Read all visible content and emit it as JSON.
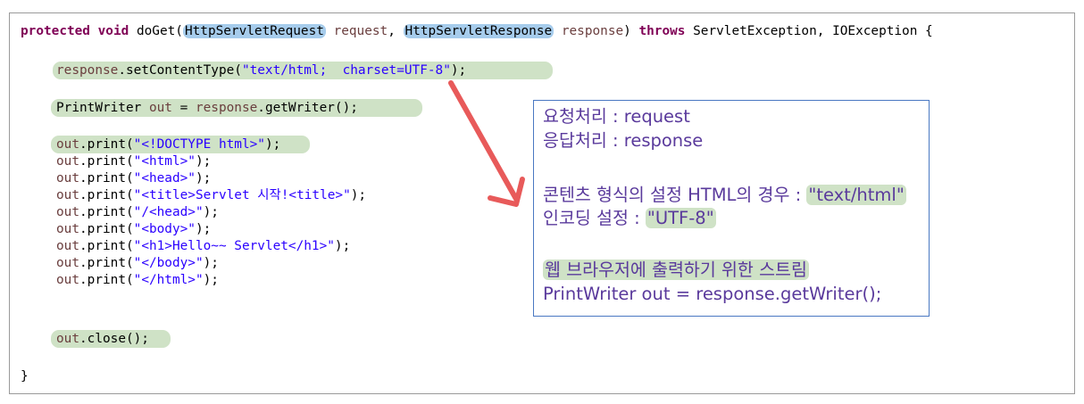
{
  "code": {
    "signature": {
      "modifiers": "protected void",
      "method_open": " doGet(",
      "request_type": "HttpServletRequest",
      "request_param": " request",
      "comma": ", ",
      "response_type": "HttpServletResponse",
      "response_param": " response",
      "close_paren": ") ",
      "throws_kw": "throws",
      "exceptions": " ServletException, IOException {"
    },
    "set_content_type": {
      "obj": "response",
      "call": ".setContentType(",
      "arg": "\"text/html;  charset=UTF-8\"",
      "end": ");"
    },
    "print_writer": {
      "type": "PrintWriter ",
      "var": "out",
      "eq": " = ",
      "obj": "response",
      "call": ".getWriter();"
    },
    "print_lines": [
      {
        "obj": "out",
        "call": ".print(",
        "arg": "\"<!DOCTYPE html>\"",
        "end": ");"
      },
      {
        "obj": "out",
        "call": ".print(",
        "arg": "\"<html>\"",
        "end": ");"
      },
      {
        "obj": "out",
        "call": ".print(",
        "arg": "\"<head>\"",
        "end": ");"
      },
      {
        "obj": "out",
        "call": ".print(",
        "arg": "\"<title>Servlet 시작!<title>\"",
        "end": ");"
      },
      {
        "obj": "out",
        "call": ".print(",
        "arg": "\"/<head>\"",
        "end": ");"
      },
      {
        "obj": "out",
        "call": ".print(",
        "arg": "\"<body>\"",
        "end": ");"
      },
      {
        "obj": "out",
        "call": ".print(",
        "arg": "\"<h1>Hello~~ Servlet</h1>\"",
        "end": ");"
      },
      {
        "obj": "out",
        "call": ".print(",
        "arg": "\"</body>\"",
        "end": ");"
      },
      {
        "obj": "out",
        "call": ".print(",
        "arg": "\"</html>\"",
        "end": ");"
      }
    ],
    "close_line": {
      "obj": "out",
      "call": ".close();"
    },
    "closing_brace": "}"
  },
  "note": {
    "request_line": "요청처리 : request",
    "response_line": "응답처리 : response",
    "content_type_prefix": "콘텐츠 형식의 설정 HTML의 경우 : ",
    "content_type_value": "\"text/html\"",
    "encoding_prefix": "인코딩 설정 : ",
    "encoding_value": "\"UTF-8\"",
    "stream_desc": "웹 브라우저에 출력하기 위한 스트림",
    "stream_code": "PrintWriter out = response.getWriter();"
  },
  "colors": {
    "keyword": "#7f0055",
    "string": "#2a00ff",
    "field": "#0000c0",
    "highlight_green": "#cfe2c6",
    "highlight_blue": "#a6ccec",
    "note_text": "#5a3a9c",
    "note_border": "#4a78c2",
    "arrow": "#e85a5a"
  }
}
